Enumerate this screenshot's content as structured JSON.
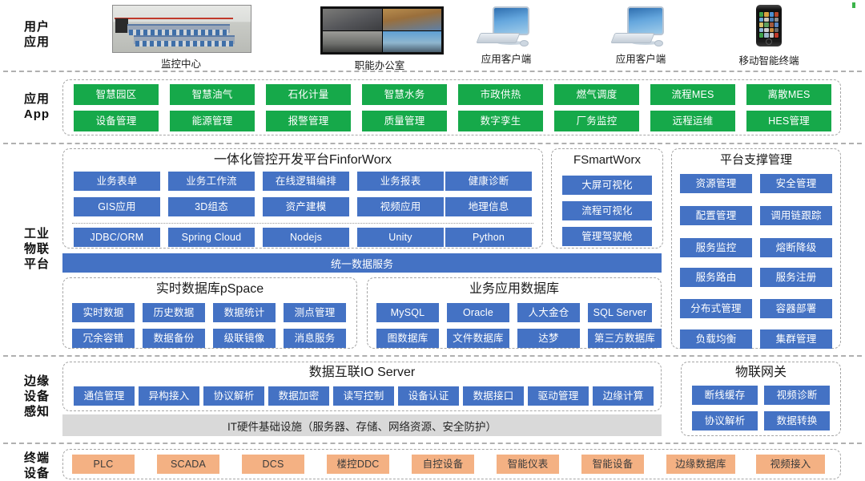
{
  "layers": {
    "user_application": "用户\n应用",
    "user_application_lines": [
      "用户",
      "应用"
    ],
    "application_app_lines": [
      "应用",
      "App"
    ],
    "iot_platform_lines": [
      "工业",
      "物联",
      "平台"
    ],
    "edge_device_lines": [
      "边缘",
      "设备",
      "感知"
    ],
    "terminal_device_lines": [
      "终端",
      "设备"
    ]
  },
  "top_row": {
    "items": [
      {
        "caption": "监控中心",
        "icon": "monitoring-room-photo"
      },
      {
        "caption": "职能办公室",
        "icon": "video-wall-photo"
      },
      {
        "caption": "应用客户端",
        "icon": "desktop-computer-icon"
      },
      {
        "caption": "应用客户端",
        "icon": "desktop-computer-icon"
      },
      {
        "caption": "移动智能终端",
        "icon": "smartphone-icon"
      }
    ]
  },
  "app_layer": {
    "row1": [
      "智慧园区",
      "智慧油气",
      "石化计量",
      "智慧水务",
      "市政供热",
      "燃气调度",
      "流程MES",
      "离散MES"
    ],
    "row2": [
      "设备管理",
      "能源管理",
      "报警管理",
      "质量管理",
      "数字孪生",
      "厂务监控",
      "远程运维",
      "HES管理"
    ]
  },
  "finforworx": {
    "title": "一体化管控开发平台FinforWorx",
    "row1": [
      "业务表单",
      "业务工作流",
      "在线逻辑编排",
      "业务报表",
      "健康诊断"
    ],
    "row2": [
      "GIS应用",
      "3D组态",
      "资产建模",
      "视频应用",
      "地理信息"
    ],
    "row3": [
      "JDBC/ORM",
      "Spring Cloud",
      "Nodejs",
      "Unity",
      "Python"
    ]
  },
  "fsmartworx": {
    "title": "FSmartWorx",
    "items": [
      "大屏可视化",
      "流程可视化",
      "管理驾驶舱"
    ]
  },
  "platform_support": {
    "title": "平台支撑管理",
    "left_column": [
      "资源管理",
      "配置管理",
      "服务监控",
      "服务路由",
      "分布式管理",
      "负载均衡"
    ],
    "right_column": [
      "安全管理",
      "调用链跟踪",
      "熔断降级",
      "服务注册",
      "容器部署",
      "集群管理"
    ]
  },
  "unified_data_service": "统一数据服务",
  "pspace": {
    "title": "实时数据库pSpace",
    "row1": [
      "实时数据",
      "历史数据",
      "数据统计",
      "测点管理"
    ],
    "row2": [
      "冗余容错",
      "数据备份",
      "级联镜像",
      "消息服务"
    ]
  },
  "business_db": {
    "title": "业务应用数据库",
    "row1": [
      "MySQL",
      "Oracle",
      "人大金仓",
      "SQL Server"
    ],
    "row2": [
      "图数据库",
      "文件数据库",
      "达梦",
      "第三方数据库"
    ]
  },
  "io_server": {
    "title": "数据互联IO Server",
    "items": [
      "通信管理",
      "异构接入",
      "协议解析",
      "数据加密",
      "读写控制",
      "设备认证",
      "数据接口",
      "驱动管理",
      "边缘计算"
    ]
  },
  "iot_gateway": {
    "title": "物联网关",
    "row1": [
      "断线缓存",
      "视频诊断"
    ],
    "row2": [
      "协议解析",
      "数据转换"
    ]
  },
  "it_infrastructure": "IT硬件基础设施（服务器、存储、网络资源、安全防护）",
  "terminal_layer": {
    "items": [
      "PLC",
      "SCADA",
      "DCS",
      "楼控DDC",
      "自控设备",
      "智能仪表",
      "智能设备",
      "边缘数据库",
      "视频接入"
    ]
  },
  "colors": {
    "green": "#16a94a",
    "blue": "#4472c4",
    "orange": "#f4b183",
    "gray": "#d9d9d9",
    "dash_border": "#a6a6a6"
  }
}
